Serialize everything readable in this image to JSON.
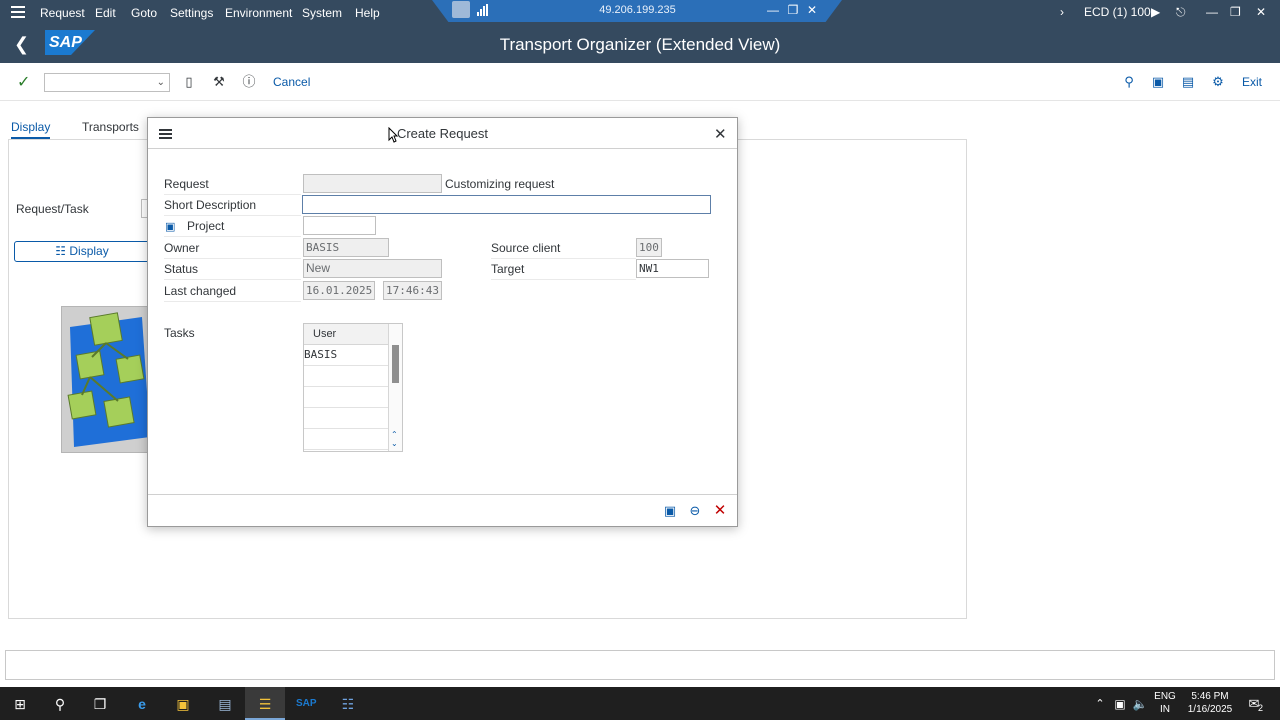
{
  "menubar": {
    "items": [
      "Request",
      "Edit",
      "Goto",
      "Settings",
      "Environment",
      "System",
      "Help"
    ],
    "remote_ip": "49.206.199.235",
    "system_label": "ECD (1) 100"
  },
  "titlebar": {
    "logo": "SAP",
    "title": "Transport Organizer (Extended View)"
  },
  "toolbar": {
    "command_field_value": "",
    "cancel_label": "Cancel",
    "exit_label": "Exit"
  },
  "background": {
    "tabs": [
      "Display",
      "Transports"
    ],
    "request_task_label": "Request/Task",
    "display_button_label": "Display"
  },
  "dialog": {
    "title": "Create Request",
    "fields": {
      "request_label": "Request",
      "request_value": "",
      "request_type": "Customizing request",
      "short_description_label": "Short Description",
      "short_description_value": "",
      "project_label": "Project",
      "project_value": "",
      "owner_label": "Owner",
      "owner_value": "BASIS",
      "status_label": "Status",
      "status_value": "New",
      "last_changed_label": "Last changed",
      "last_changed_date": "16.01.2025",
      "last_changed_time": "17:46:43",
      "source_client_label": "Source client",
      "source_client_value": "100",
      "target_label": "Target",
      "target_value": "NW1"
    },
    "tasks": {
      "label": "Tasks",
      "column_header": "User",
      "rows": [
        "BASIS",
        "",
        "",
        "",
        ""
      ]
    }
  },
  "taskbar": {
    "lang_top": "ENG",
    "lang_bottom": "IN",
    "time": "5:46 PM",
    "date": "1/16/2025",
    "notification_count": "2"
  },
  "colors": {
    "shell_header": "#354a5f",
    "link_blue": "#0a5aa8",
    "close_red": "#c00000",
    "confirm_green": "#2a7d2a"
  }
}
